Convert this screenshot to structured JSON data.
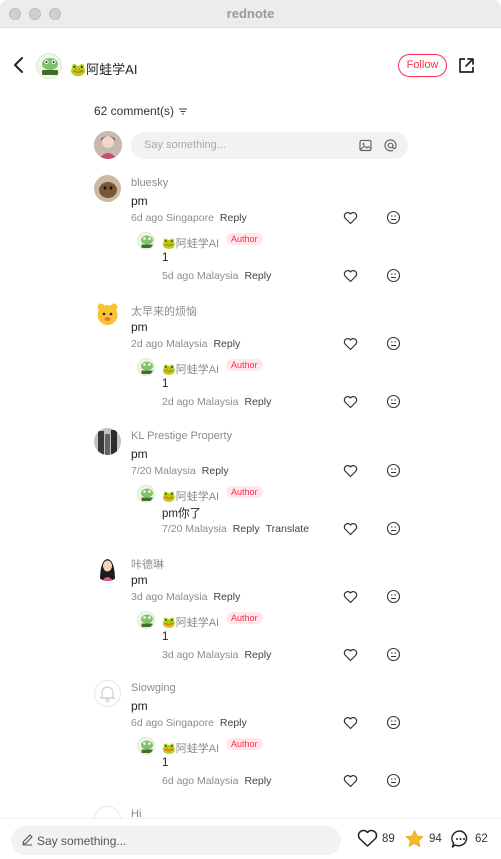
{
  "window": {
    "title": "rednote"
  },
  "header": {
    "author_name": "🐸阿蛙学AI",
    "follow_label": "Follow"
  },
  "comments_summary": {
    "count_label": "62 comment(s)"
  },
  "composer": {
    "placeholder": "Say something..."
  },
  "comments": [
    {
      "name": "bluesky",
      "text": "pm",
      "meta": "6d ago Singapore",
      "reply_label": "Reply",
      "reply": {
        "name": "🐸阿蛙学AI",
        "badge": "Author",
        "text": "1",
        "meta": "5d ago Malaysia",
        "reply_label": "Reply"
      }
    },
    {
      "name": "太早来的烦恼",
      "text": "pm",
      "meta": "2d ago Malaysia",
      "reply_label": "Reply",
      "reply": {
        "name": "🐸阿蛙学AI",
        "badge": "Author",
        "text": "1",
        "meta": "2d ago Malaysia",
        "reply_label": "Reply"
      }
    },
    {
      "name": "KL Prestige Property",
      "text": "pm",
      "meta": "7/20 Malaysia",
      "reply_label": "Reply",
      "reply": {
        "name": "🐸阿蛙学AI",
        "badge": "Author",
        "text": "pm你了",
        "meta": "7/20 Malaysia",
        "reply_label": "Reply",
        "translate_label": "Translate"
      }
    },
    {
      "name": "咔德琳",
      "text": "pm",
      "meta": "3d ago Malaysia",
      "reply_label": "Reply",
      "reply": {
        "name": "🐸阿蛙学AI",
        "badge": "Author",
        "text": "1",
        "meta": "3d ago Malaysia",
        "reply_label": "Reply"
      }
    },
    {
      "name": "Siowging",
      "text": "pm",
      "meta": "6d ago Singapore",
      "reply_label": "Reply",
      "reply": {
        "name": "🐸阿蛙学AI",
        "badge": "Author",
        "text": "1",
        "meta": "6d ago Malaysia",
        "reply_label": "Reply"
      }
    }
  ],
  "partial_comment": {
    "name": "Hi"
  },
  "bottom_bar": {
    "placeholder": "Say something...",
    "likes": "89",
    "collects": "94",
    "comments": "62"
  },
  "colors": {
    "accent": "#ff2e4d",
    "star": "#f5b82e"
  }
}
